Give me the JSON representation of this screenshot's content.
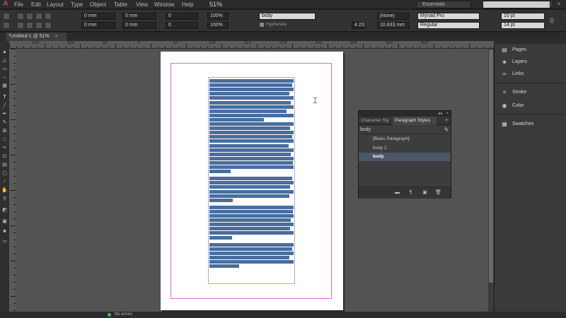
{
  "menubar": {
    "app_icon": "A",
    "items": [
      "File",
      "Edit",
      "Layout",
      "Type",
      "Object",
      "Table",
      "View",
      "Window",
      "Help"
    ],
    "zoom": "51%",
    "workspace": "Essentials",
    "window_controls": [
      "–",
      "□",
      "×"
    ]
  },
  "control": {
    "x": "0 mm",
    "y": "0 mm",
    "w": "0 mm",
    "h": "0 mm",
    "scale_x": "100%",
    "scale_y": "100%",
    "rot": "0",
    "shear": "0",
    "para_style": "body",
    "hyphenate": "Hyphenate",
    "baseline_val": "4.233",
    "baseline_mm": "10.833 mm",
    "none": "[None]",
    "font": "Myriad Pro",
    "font_style": "Regular",
    "size": "10 pt",
    "leading": "14 pt"
  },
  "document": {
    "tab_title": "*Untitled-1 @ 51%",
    "close": "×"
  },
  "ruler": {
    "labels": [
      "150",
      "100",
      "50",
      "0",
      "50",
      "100",
      "150",
      "200",
      "250",
      "300",
      "350",
      "400"
    ]
  },
  "dock": {
    "items": [
      {
        "label": "Pages",
        "icon": "pages-icon"
      },
      {
        "label": "Layers",
        "icon": "layers-icon"
      },
      {
        "label": "Links",
        "icon": "links-icon"
      },
      {
        "label": "Stroke",
        "icon": "stroke-icon"
      },
      {
        "label": "Color",
        "icon": "color-icon"
      },
      {
        "label": "Swatches",
        "icon": "swatches-icon"
      }
    ]
  },
  "paragraph_panel": {
    "tabs": [
      "Character Sty",
      "Paragraph Styles"
    ],
    "current_style": "body",
    "styles": [
      "[Basic Paragraph]",
      "body 2",
      "body"
    ],
    "selected_index": 2
  },
  "status": {
    "errors": "No errors"
  }
}
